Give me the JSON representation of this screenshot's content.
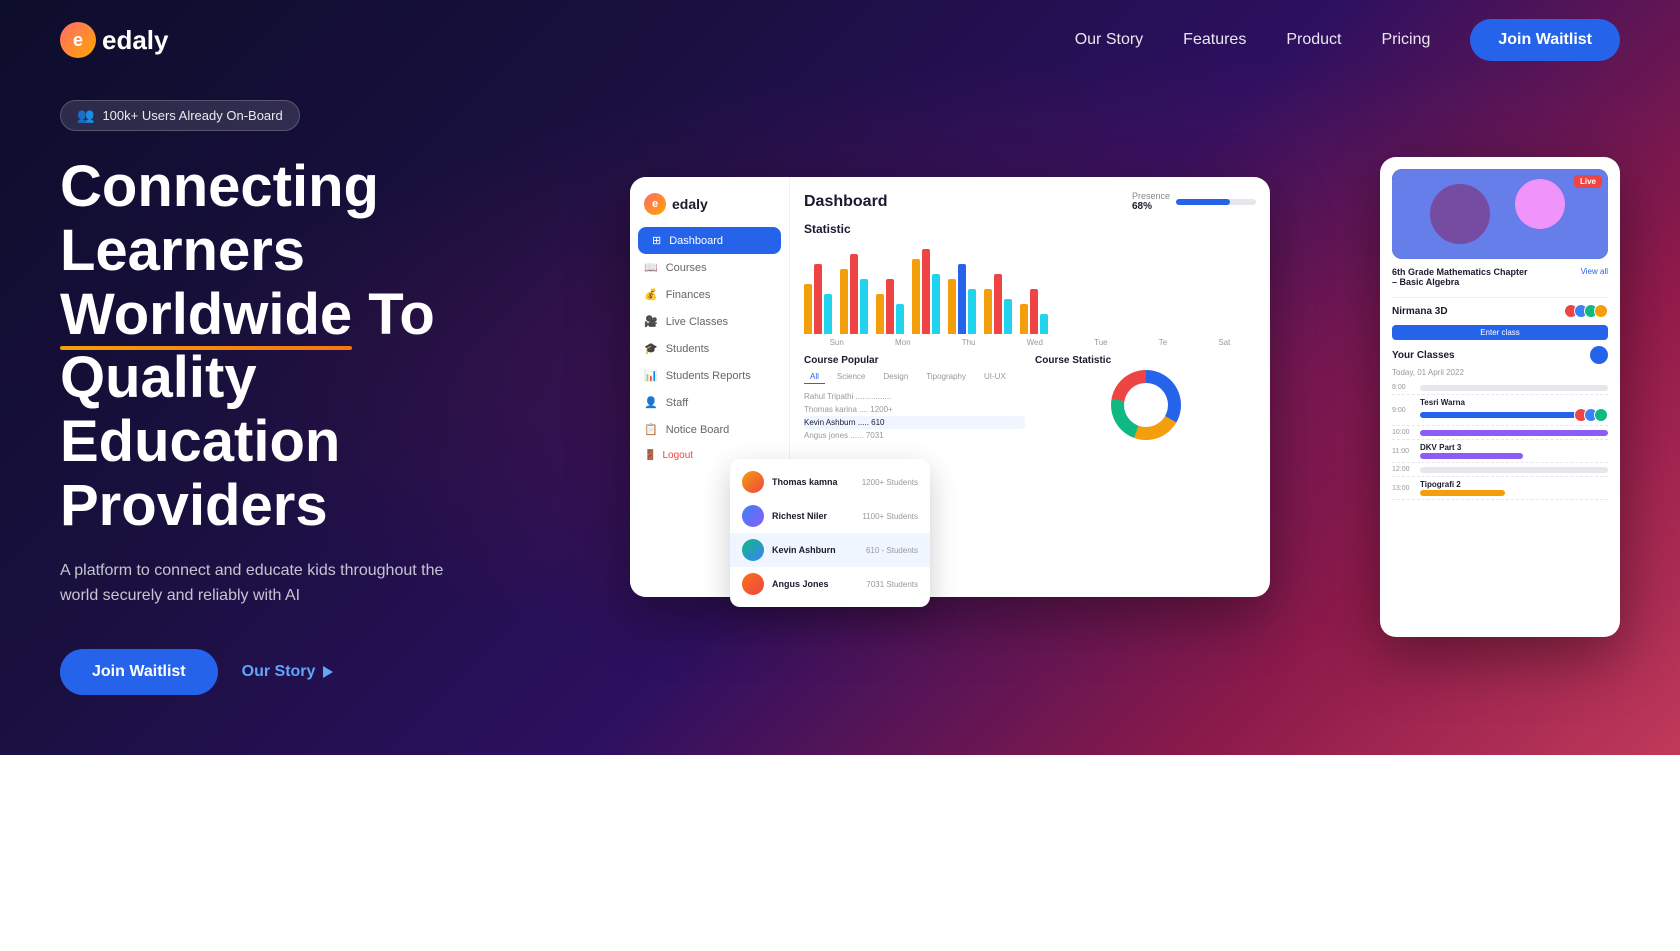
{
  "nav": {
    "logo_text": "edaly",
    "links": [
      "Our Story",
      "Features",
      "Product",
      "Pricing"
    ],
    "cta": "Join Waitlist"
  },
  "hero": {
    "badge": "100k+ Users Already On-Board",
    "title_line1": "Connecting Learners",
    "title_line2_part1": "Worldwide",
    "title_line2_part2": " To Quality",
    "title_line3": "Education Providers",
    "subtitle": "A platform to connect and educate kids throughout the world securely and reliably with AI",
    "cta_primary": "Join Waitlist",
    "cta_secondary": "Our Story"
  },
  "dashboard": {
    "title": "Dashboard",
    "nav_items": [
      "Dashboard",
      "Courses",
      "Finances",
      "Live Classes",
      "Students",
      "Students Reports",
      "Staff",
      "Notice Board"
    ],
    "presence": "68%",
    "statistic_label": "Statistic",
    "bar_days": [
      "Sun",
      "Mon",
      "Thu",
      "Wed",
      "Tue",
      "Te",
      "Sat"
    ],
    "course_popular": "Course Popular",
    "course_stat": "Course Statistic",
    "tabs": [
      "All",
      "Science",
      "Design",
      "Tipography",
      "UI-UX"
    ],
    "logout": "Logout"
  },
  "schedule": {
    "live_badge": "Live",
    "class_name": "6th Grade Mathematics Chapter – Basic Algebra",
    "view_all": "View all",
    "nirmana": "Nirmana 3D",
    "enter_class": "Enter class",
    "your_classes": "Your Classes",
    "date": "Today, 01 April 2022",
    "times": [
      "8:00",
      "9:00",
      "9:00",
      "10:00",
      "11:00",
      "12:00",
      "13:00"
    ],
    "class_names": [
      "Tesri Warna",
      "DKV Part 3",
      "Tipografi 2"
    ]
  },
  "dropdown": {
    "people": [
      {
        "name": "Thomas kamna",
        "stat": "1200+ Students"
      },
      {
        "name": "Richest Niler",
        "stat": "1100+ Students"
      },
      {
        "name": "Kevin Ashburn",
        "stat": "610 - Students"
      },
      {
        "name": "Angus Jones",
        "stat": "7031 Students"
      }
    ]
  },
  "colors": {
    "primary": "#2563eb",
    "accent": "#f59e0b",
    "hero_bg_start": "#0d0d2b",
    "hero_bg_end": "#c0395a"
  }
}
